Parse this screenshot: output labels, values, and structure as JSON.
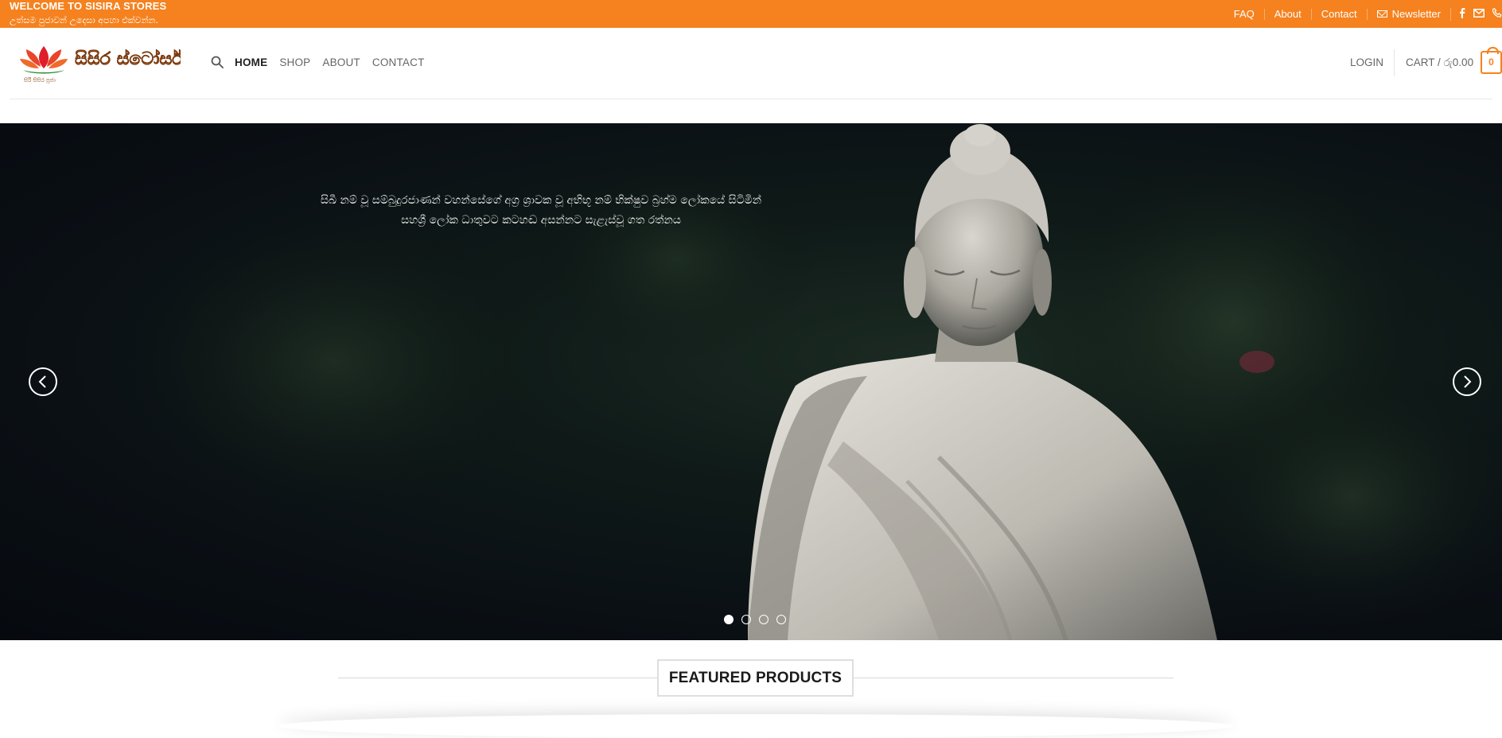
{
  "topbar": {
    "welcome": "WELCOME TO SISIRA STORES",
    "tagline": "උත්සම පුජාවන් උදෙසා අපහා එක්වන්න.",
    "links": {
      "faq": "FAQ",
      "about": "About",
      "contact": "Contact",
      "newsletter": "Newsletter"
    },
    "icons": [
      "facebook-icon",
      "email-icon",
      "phone-icon"
    ],
    "color": "#f5821f"
  },
  "header": {
    "logo_text": "සිසිර ස්ටෝර්ස්",
    "logo_subtext": "සිරි සිසිර පූජා",
    "nav": [
      "HOME",
      "SHOP",
      "ABOUT",
      "CONTACT"
    ],
    "active_nav": "HOME",
    "login": "LOGIN",
    "cart_label": "CART / ",
    "cart_amount": "රු0.00",
    "cart_count": "0"
  },
  "hero": {
    "quote_line1": "සිඛී නම් වූ සම්බුදුරජාණන් වහන්සේගේ අග්‍ර ශ්‍රාවක වූ අභිභූ නම් භික්ෂුව බ්‍රහ්ම ලෝකයේ සිටිමින්",
    "quote_line2": "සහශ්‍රී ලෝක ධාතුවට කටහඬ අසන්නට සැළැස්වූ ගත රත්නය",
    "slides": 4,
    "active_slide": 1
  },
  "featured": {
    "title": "FEATURED PRODUCTS"
  }
}
